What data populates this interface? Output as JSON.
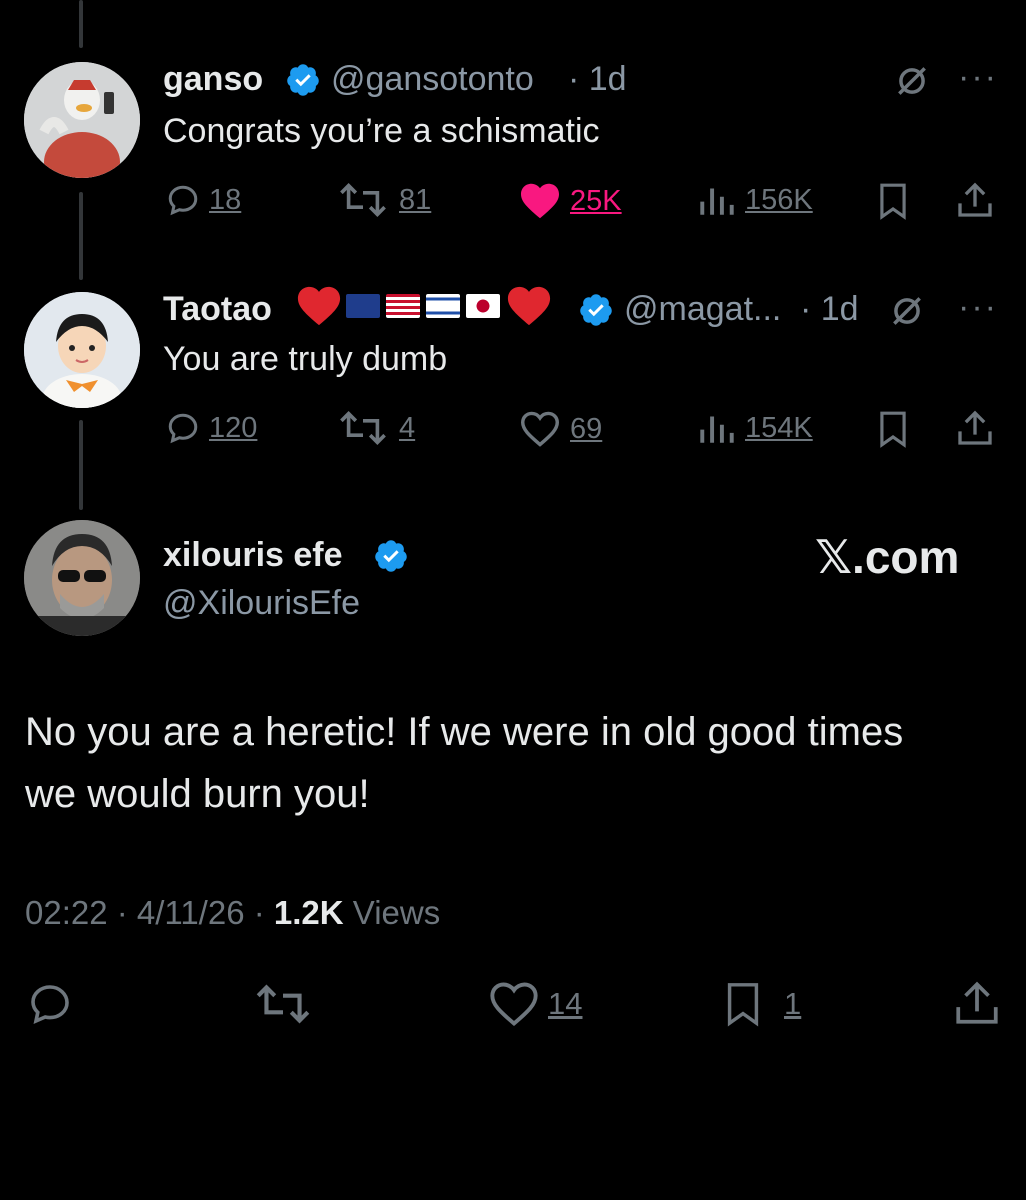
{
  "tweets": [
    {
      "name": "ganso",
      "handle": "@gansotonto",
      "time": "· 1d",
      "text": "Congrats you’re a schismatic",
      "replies": "18",
      "retweets": "81",
      "likes": "25K",
      "views": "156K"
    },
    {
      "name": "Taotao",
      "handle": "@magat...",
      "time": "· 1d",
      "text": "You are truly dumb",
      "replies": "120",
      "retweets": "4",
      "likes": "69",
      "views": "154K"
    }
  ],
  "main": {
    "name": "xilouris efe",
    "handle": "@XilourisEfe",
    "brand": "𝕏.com",
    "text_line1": "No you are a heretic! If we were in old good times",
    "text_line2": "we would burn you!",
    "timestamp": "02:22 · 4/11/26 ·",
    "views_count": "1.2K",
    "views_label": "Views",
    "likes": "14",
    "bookmarks": "1"
  },
  "colors": {
    "background": "#000000",
    "muted": "#6e767d",
    "like_pink": "#f91880",
    "verified_blue": "#1d9bf0"
  }
}
